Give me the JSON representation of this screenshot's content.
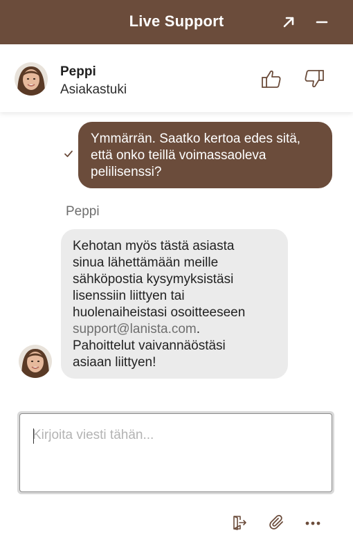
{
  "header": {
    "title": "Live Support",
    "expand_icon": "arrow-up-right-icon",
    "minimize_icon": "minus-icon"
  },
  "agent": {
    "name": "Peppi",
    "role": "Asiakastuki",
    "thumbs_up_icon": "thumbs-up-icon",
    "thumbs_down_icon": "thumbs-down-icon"
  },
  "messages": [
    {
      "direction": "outgoing",
      "status_icon": "checkmark-icon",
      "lines": [
        "Ymmärrän. Saatko kertoa edes sitä,",
        "että onko teillä voimassaoleva",
        "pelilisenssi?"
      ]
    },
    {
      "direction": "incoming",
      "sender": "Peppi",
      "lines": [
        "Kehotan myös tästä asiasta",
        "sinua lähettämään meille",
        "sähköpostia kysymyksistäsi",
        "lisenssiin liittyen tai",
        "huolenaiheistasi osoitteeseen"
      ],
      "link": "support@lanista.com",
      "link_suffix": ".",
      "tail_lines": [
        "Pahoittelut vaivannäöstäsi",
        "asiaan liittyen!"
      ]
    }
  ],
  "composer": {
    "placeholder": "Kirjoita viesti tähän...",
    "value": ""
  },
  "toolbar": {
    "icons": [
      "exit-icon",
      "paperclip-icon",
      "more-dots-icon"
    ]
  },
  "colors": {
    "brand": "#6b4c3b",
    "incoming_bubble": "#ebebeb",
    "link": "#6f6f6f"
  }
}
